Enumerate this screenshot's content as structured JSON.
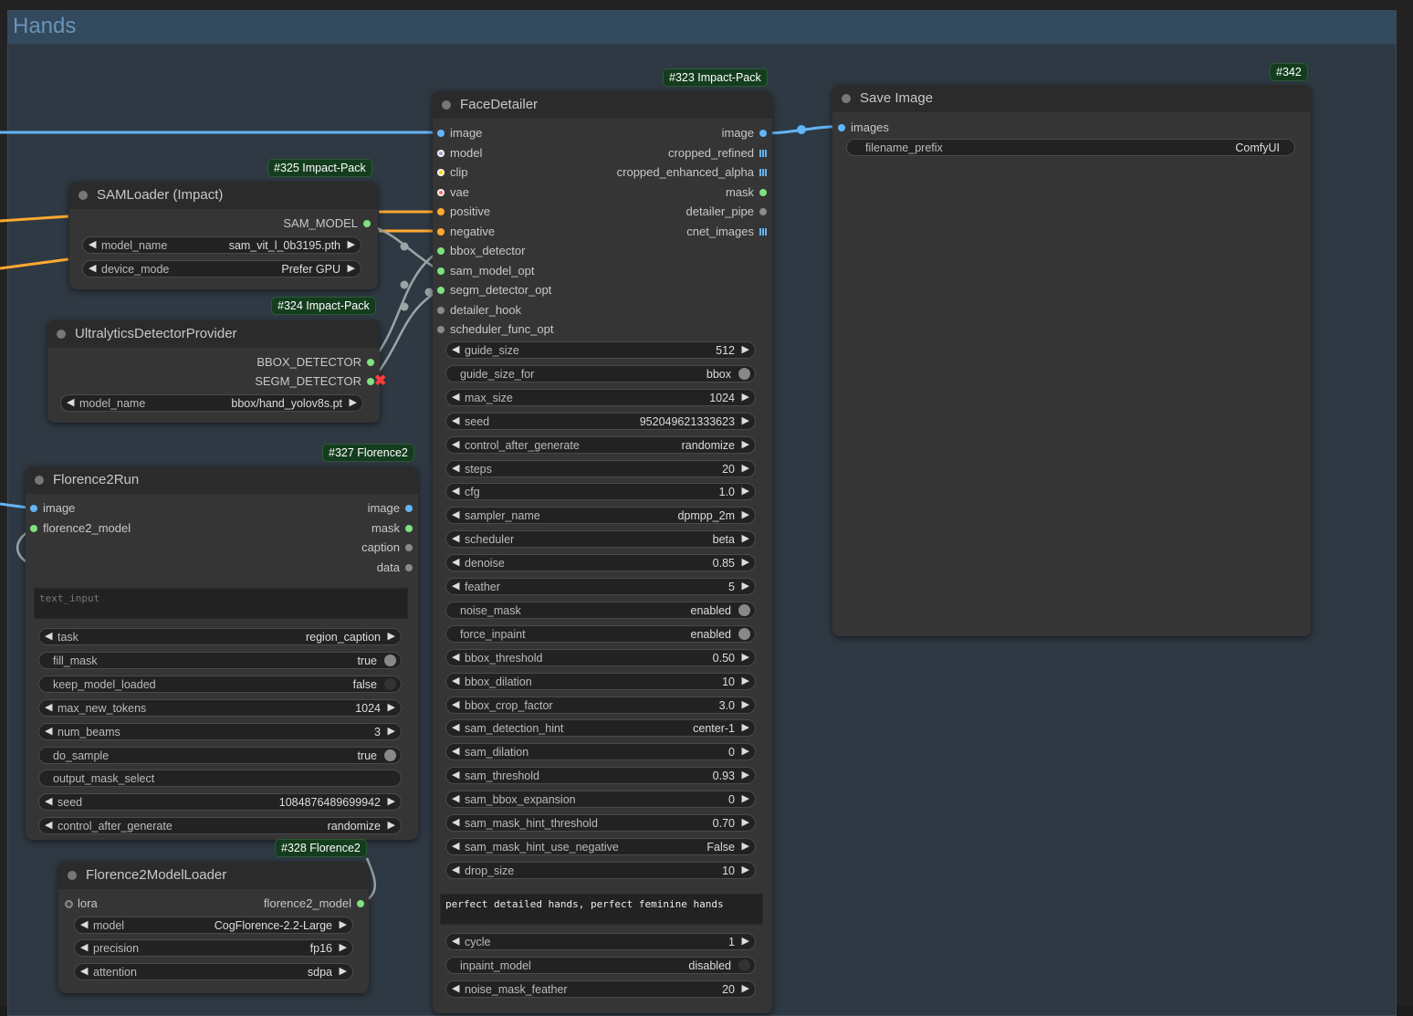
{
  "group": {
    "title": "Hands"
  },
  "colors": {
    "image": "#64b5f6",
    "model": "#b39ddb",
    "clip": "#ffd500",
    "vae": "#ff6e6e",
    "conditioning": "#ffa931",
    "green": "#7fe27f",
    "gray": "#8a8a8a",
    "link_blue": "#64b5f6",
    "link_orange": "#ffa931",
    "link_gray": "#9aa5a5"
  },
  "samloader": {
    "badge": "#325 Impact-Pack",
    "title": "SAMLoader (Impact)",
    "output": "SAM_MODEL",
    "widgets": [
      {
        "name": "model_name",
        "value": "sam_vit_l_0b3195.pth"
      },
      {
        "name": "device_mode",
        "value": "Prefer GPU"
      }
    ]
  },
  "ultralytics": {
    "badge": "#324 Impact-Pack",
    "title": "UltralyticsDetectorProvider",
    "outputs": [
      "BBOX_DETECTOR",
      "SEGM_DETECTOR"
    ],
    "widgets": [
      {
        "name": "model_name",
        "value": "bbox/hand_yolov8s.pt"
      }
    ]
  },
  "florence_run": {
    "badge": "#327 Florence2",
    "title": "Florence2Run",
    "inputs": [
      "image",
      "florence2_model"
    ],
    "outputs": [
      "image",
      "mask",
      "caption",
      "data"
    ],
    "text_input_placeholder": "text_input",
    "widgets": [
      {
        "name": "task",
        "value": "region_caption",
        "kind": "combo"
      },
      {
        "name": "fill_mask",
        "value": "true",
        "kind": "toggle"
      },
      {
        "name": "keep_model_loaded",
        "value": "false",
        "kind": "toggle"
      },
      {
        "name": "max_new_tokens",
        "value": "1024",
        "kind": "combo"
      },
      {
        "name": "num_beams",
        "value": "3",
        "kind": "combo"
      },
      {
        "name": "do_sample",
        "value": "true",
        "kind": "toggle"
      },
      {
        "name": "output_mask_select",
        "value": "",
        "kind": "plain"
      },
      {
        "name": "seed",
        "value": "1084876489699942",
        "kind": "combo"
      },
      {
        "name": "control_after_generate",
        "value": "randomize",
        "kind": "combo"
      }
    ]
  },
  "florence_loader": {
    "badge": "#328 Florence2",
    "title": "Florence2ModelLoader",
    "input": "lora",
    "output": "florence2_model",
    "widgets": [
      {
        "name": "model",
        "value": "CogFlorence-2.2-Large"
      },
      {
        "name": "precision",
        "value": "fp16"
      },
      {
        "name": "attention",
        "value": "sdpa"
      }
    ]
  },
  "facedetailer": {
    "badge": "#323 Impact-Pack",
    "title": "FaceDetailer",
    "inputs": [
      "image",
      "model",
      "clip",
      "vae",
      "positive",
      "negative",
      "bbox_detector",
      "sam_model_opt",
      "segm_detector_opt",
      "detailer_hook",
      "scheduler_func_opt"
    ],
    "outputs": [
      "image",
      "cropped_refined",
      "cropped_enhanced_alpha",
      "mask",
      "detailer_pipe",
      "cnet_images"
    ],
    "widgets": [
      {
        "name": "guide_size",
        "value": "512",
        "kind": "combo"
      },
      {
        "name": "guide_size_for",
        "value": "bbox",
        "kind": "toggle"
      },
      {
        "name": "max_size",
        "value": "1024",
        "kind": "combo"
      },
      {
        "name": "seed",
        "value": "952049621333623",
        "kind": "combo"
      },
      {
        "name": "control_after_generate",
        "value": "randomize",
        "kind": "combo"
      },
      {
        "name": "steps",
        "value": "20",
        "kind": "combo"
      },
      {
        "name": "cfg",
        "value": "1.0",
        "kind": "combo"
      },
      {
        "name": "sampler_name",
        "value": "dpmpp_2m",
        "kind": "combo"
      },
      {
        "name": "scheduler",
        "value": "beta",
        "kind": "combo"
      },
      {
        "name": "denoise",
        "value": "0.85",
        "kind": "combo"
      },
      {
        "name": "feather",
        "value": "5",
        "kind": "combo"
      },
      {
        "name": "noise_mask",
        "value": "enabled",
        "kind": "toggle"
      },
      {
        "name": "force_inpaint",
        "value": "enabled",
        "kind": "toggle"
      },
      {
        "name": "bbox_threshold",
        "value": "0.50",
        "kind": "combo"
      },
      {
        "name": "bbox_dilation",
        "value": "10",
        "kind": "combo"
      },
      {
        "name": "bbox_crop_factor",
        "value": "3.0",
        "kind": "combo"
      },
      {
        "name": "sam_detection_hint",
        "value": "center-1",
        "kind": "combo"
      },
      {
        "name": "sam_dilation",
        "value": "0",
        "kind": "combo"
      },
      {
        "name": "sam_threshold",
        "value": "0.93",
        "kind": "combo"
      },
      {
        "name": "sam_bbox_expansion",
        "value": "0",
        "kind": "combo"
      },
      {
        "name": "sam_mask_hint_threshold",
        "value": "0.70",
        "kind": "combo"
      },
      {
        "name": "sam_mask_hint_use_negative",
        "value": "False",
        "kind": "combo"
      },
      {
        "name": "drop_size",
        "value": "10",
        "kind": "combo"
      }
    ],
    "wildcard": "perfect detailed hands, perfect feminine hands",
    "widgets2": [
      {
        "name": "cycle",
        "value": "1",
        "kind": "combo"
      },
      {
        "name": "inpaint_model",
        "value": "disabled",
        "kind": "toggle"
      },
      {
        "name": "noise_mask_feather",
        "value": "20",
        "kind": "combo"
      }
    ]
  },
  "saveimage": {
    "badge": "#342",
    "title": "Save Image",
    "input": "images",
    "widgets": [
      {
        "name": "filename_prefix",
        "value": "ComfyUI"
      }
    ]
  }
}
